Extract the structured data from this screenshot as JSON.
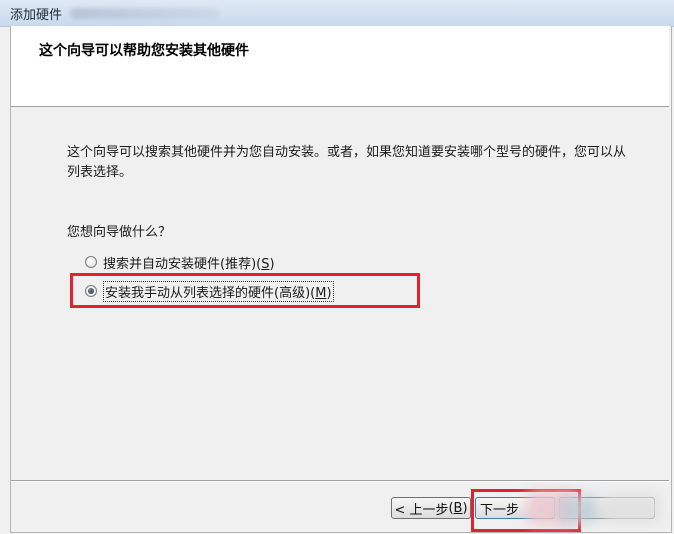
{
  "window": {
    "title": "添加硬件"
  },
  "header": {
    "heading": "这个向导可以帮助您安装其他硬件"
  },
  "body": {
    "description": "这个向导可以搜索其他硬件并为您自动安装。或者，如果您知道要安装哪个型号的硬件，您可以从列表选择。",
    "question": "您想向导做什么？"
  },
  "options": [
    {
      "label_before": "搜索并自动安装硬件(推荐)(",
      "mnemonic": "S",
      "label_after": ")",
      "selected": false
    },
    {
      "label_before": "安装我手动从列表选择的硬件(高级)(",
      "mnemonic": "M",
      "label_after": ")",
      "selected": true
    }
  ],
  "buttons": {
    "back_label": "< 上一步",
    "back_mnemonic": "B",
    "next_label": "下一步"
  },
  "colors": {
    "highlight": "#e3222c",
    "titlebar": "#c9daee"
  }
}
